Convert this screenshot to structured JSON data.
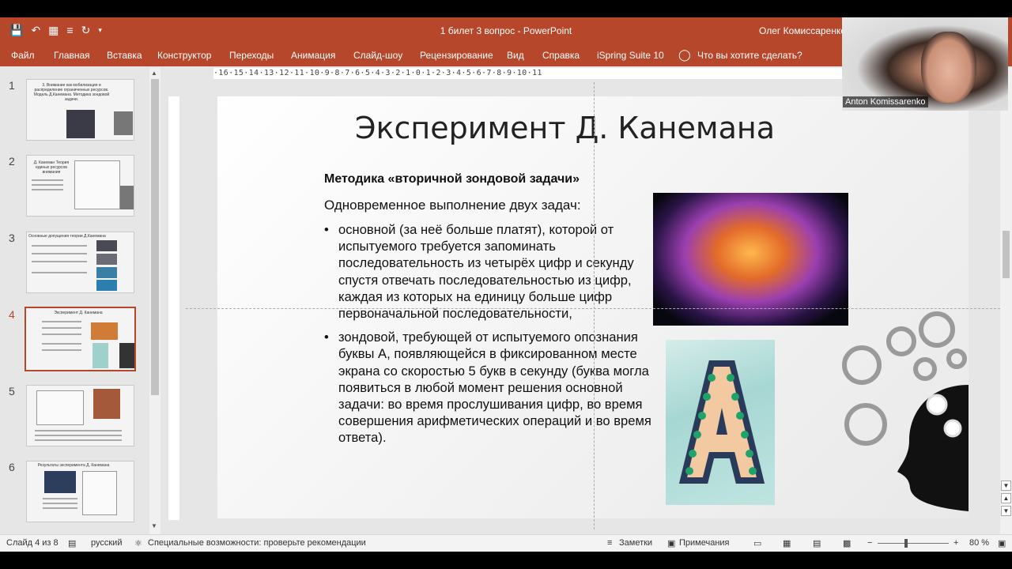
{
  "window": {
    "doc_title": "1 билет 3 вопрос  -  PowerPoint",
    "user_name": "Олег Комиссаренко"
  },
  "qat": {
    "icons": [
      "save-icon",
      "undo-icon",
      "start-from-beginning-icon",
      "bullets-icon",
      "redo-icon",
      "customize-icon"
    ]
  },
  "ribbon": {
    "tabs": [
      "Файл",
      "Главная",
      "Вставка",
      "Конструктор",
      "Переходы",
      "Анимация",
      "Слайд-шоу",
      "Рецензирование",
      "Вид",
      "Справка",
      "iSpring Suite 10"
    ],
    "tell_me": "Что вы хотите сделать?"
  },
  "ruler": {
    "labels": "·16·15·14·13·12·11·10·9·8·7·6·5·4·3·2·1·0·1·2·3·4·5·6·7·8·9·10·11"
  },
  "thumbnails": [
    {
      "number": "1",
      "caption": "3. Внимание как мобилизация и распределение ограниченных ресурсов. Модель Д.Канемана. Методика зондовой задачи."
    },
    {
      "number": "2",
      "caption": "Д. Канеман Теория единых ресурсов внимания"
    },
    {
      "number": "3",
      "caption": "Основные допущения теории Д.Канемана"
    },
    {
      "number": "4",
      "caption": "Эксперимент Д. Канемана"
    },
    {
      "number": "5",
      "caption": ""
    },
    {
      "number": "6",
      "caption": "Результаты эксперимента Д. Канемана"
    }
  ],
  "slide": {
    "title": "Эксперимент Д. Канемана",
    "method": "Методика «вторичной зондовой задачи»",
    "simultaneous": "Одновременное выполнение двух задач:",
    "bullet1": "основной (за неё больше платят), которой от испытуемого требуется запоминать последовательность из четырёх цифр и секунду спустя отвечать последовательностью из цифр, каждая из которых на единицу больше цифр первоначальной последовательности,",
    "bullet2": "зондовой, требующей от испытуемого опознания буквы А, появляющейся в фиксированном месте экрана со скоростью 5 букв в секунду (буква могла появиться в любой момент решения основной задачи: во время прослушивания цифр, во время совершения арифметических операций и во время ответа).",
    "letter_glyph": "A"
  },
  "webcam": {
    "name": "Anton Komissarenko"
  },
  "status": {
    "slide_counter": "Слайд 4 из 8",
    "language": "русский",
    "accessibility": "Специальные возможности: проверьте рекомендации",
    "notes": "Заметки",
    "comments": "Примечания",
    "zoom": "80 %"
  },
  "colors": {
    "accent": "#b7472a"
  }
}
